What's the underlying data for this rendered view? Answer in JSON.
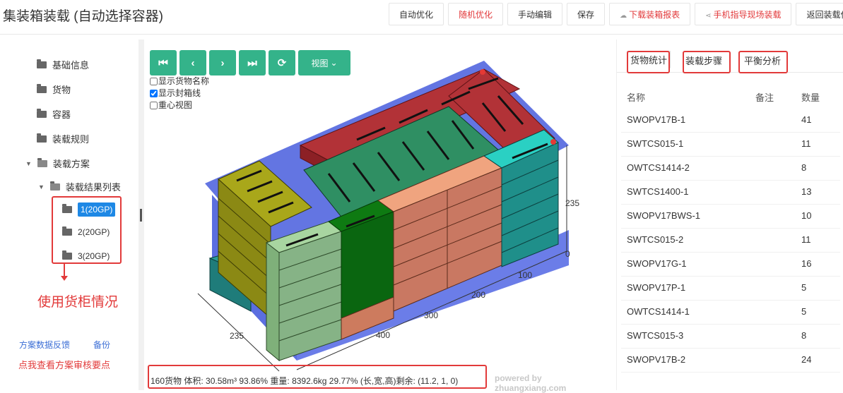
{
  "header": {
    "title": "集装箱装载 (自动选择容器)",
    "buttons": [
      "自动优化",
      "随机优化",
      "手动编辑",
      "保存",
      "下载装箱报表",
      "手机指导现场装载",
      "返回装载任"
    ]
  },
  "sidebar": {
    "items": [
      "基础信息",
      "货物",
      "容器",
      "装载规则",
      "装载方案",
      "装载结果列表"
    ],
    "plans": [
      "1(20GP)",
      "2(20GP)",
      "3(20GP)"
    ],
    "annotation": "使用货柜情况",
    "feedback_link": "方案数据反馈",
    "backup_link": "备份",
    "review_note": "点我查看方案审核要点"
  },
  "viewer": {
    "nav_view_label": "视图",
    "options": [
      {
        "label": "显示货物名称",
        "checked": false
      },
      {
        "label": "显示封箱线",
        "checked": true
      },
      {
        "label": "重心视图",
        "checked": false
      }
    ],
    "axis_labels": {
      "height": "235",
      "zero": "0",
      "width": "235",
      "l100": "100",
      "l200": "200",
      "l300": "300",
      "l400": "400"
    },
    "status": "160货物 体积: 30.58m³ 93.86% 重量: 8392.6kg 29.77% (长,宽,高)剩余: (11.2, 1, 0)",
    "powered": "powered by zhuangxiang.com"
  },
  "colors": {
    "accent_green": "#34b38a",
    "highlight_red": "#e23a3a",
    "selected_blue": "#1e88e5"
  },
  "right": {
    "tabs": [
      "货物统计",
      "装载步骤",
      "平衡分析"
    ],
    "columns": {
      "name": "名称",
      "note": "备注",
      "qty": "数量"
    },
    "rows": [
      {
        "name": "SWOPV17B-1",
        "qty": "41"
      },
      {
        "name": "SWTCS015-1",
        "qty": "11"
      },
      {
        "name": "OWTCS1414-2",
        "qty": "8"
      },
      {
        "name": "SWTCS1400-1",
        "qty": "13"
      },
      {
        "name": "SWOPV17BWS-1",
        "qty": "10"
      },
      {
        "name": "SWTCS015-2",
        "qty": "11"
      },
      {
        "name": "SWOPV17G-1",
        "qty": "16"
      },
      {
        "name": "SWOPV17P-1",
        "qty": "5"
      },
      {
        "name": "OWTCS1414-1",
        "qty": "5"
      },
      {
        "name": "SWTCS015-3",
        "qty": "8"
      },
      {
        "name": "SWOPV17B-2",
        "qty": "24"
      }
    ]
  }
}
